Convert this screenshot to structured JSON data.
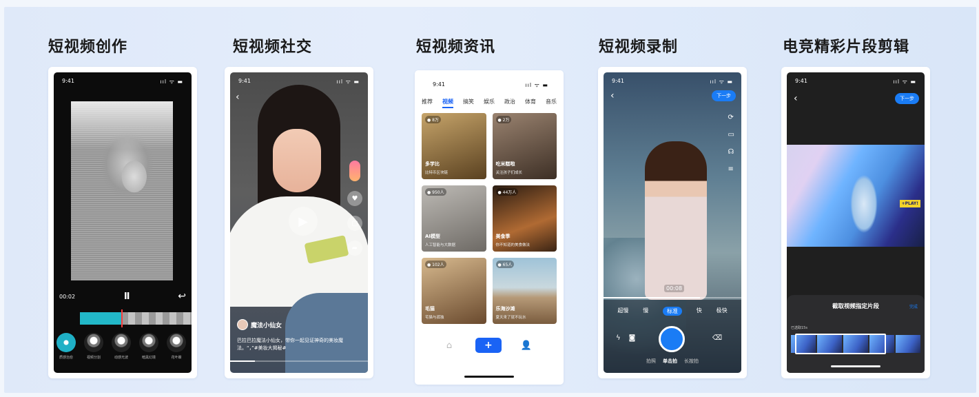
{
  "panels": [
    {
      "title": "短视频创作"
    },
    {
      "title": "短视频社交"
    },
    {
      "title": "短视频资讯"
    },
    {
      "title": "短视频录制"
    },
    {
      "title": "电竞精彩片段剪辑"
    }
  ],
  "status": {
    "time": "9:41",
    "icons": "ııl ᯤ ▬"
  },
  "creation": {
    "time_code": "00:02",
    "pause_icon": "II",
    "undo_icon": "↩",
    "effects": [
      "质感治愈",
      "视频分割",
      "动感光波",
      "暗黑幻境",
      "花叶蝶"
    ]
  },
  "social": {
    "back": "‹",
    "play": "▶",
    "username": "魔法小仙女",
    "caption": "巴拉巴拉魔法小仙女，带你一起见证神奇的美妆魔法。“，”#美妆大揭秘#",
    "side_icons": {
      "like": "♥",
      "comment": "▢",
      "share": "➦"
    }
  },
  "news": {
    "tabs": [
      "推荐",
      "视频",
      "搞笑",
      "娱乐",
      "政治",
      "体育",
      "音乐"
    ],
    "active_tab": "视频",
    "tiles": [
      {
        "views": "● 8万",
        "title": "多学比",
        "sub": "比特币区块链",
        "color": "#8c6b3c"
      },
      {
        "views": "● 2万",
        "title": "吃米糕啦",
        "sub": "关注孩子们成长",
        "color": "#6b5a4c"
      },
      {
        "views": "● 950人",
        "title": "AI模型",
        "sub": "人工智能与大数据",
        "color": "#8d8a86"
      },
      {
        "views": "● 44万人",
        "title": "美食季",
        "sub": "你不知道的美食做法",
        "color": "#5c3d26"
      },
      {
        "views": "● 102人",
        "title": "毛猫",
        "sub": "宅猫与孤独",
        "color": "#8f7252"
      },
      {
        "views": "● 65人",
        "title": "乐海沙滩",
        "sub": "夏天来了就不玩水",
        "color": "#6f8fa0"
      }
    ],
    "bottom": {
      "home": "⌂",
      "add": "+",
      "me": "👤"
    }
  },
  "record": {
    "back": "‹",
    "next": "下一步",
    "timer": "00:08",
    "speeds": [
      "超慢",
      "慢",
      "标准",
      "快",
      "极快"
    ],
    "active_speed": "标准",
    "modes": [
      "拍照",
      "单击拍",
      "长按拍"
    ],
    "active_mode": "单击拍",
    "tool_icons": [
      "⟳",
      "▭",
      "☊",
      "≡"
    ],
    "flash_icon": "ϟ",
    "camera_icon": "◙",
    "delete_icon": "⌫"
  },
  "esports": {
    "back": "‹",
    "next": "下一步",
    "sheet_title": "截取视频指定片段",
    "done": "完成",
    "selected": "已选取15s",
    "banner": "+PLAY!"
  }
}
